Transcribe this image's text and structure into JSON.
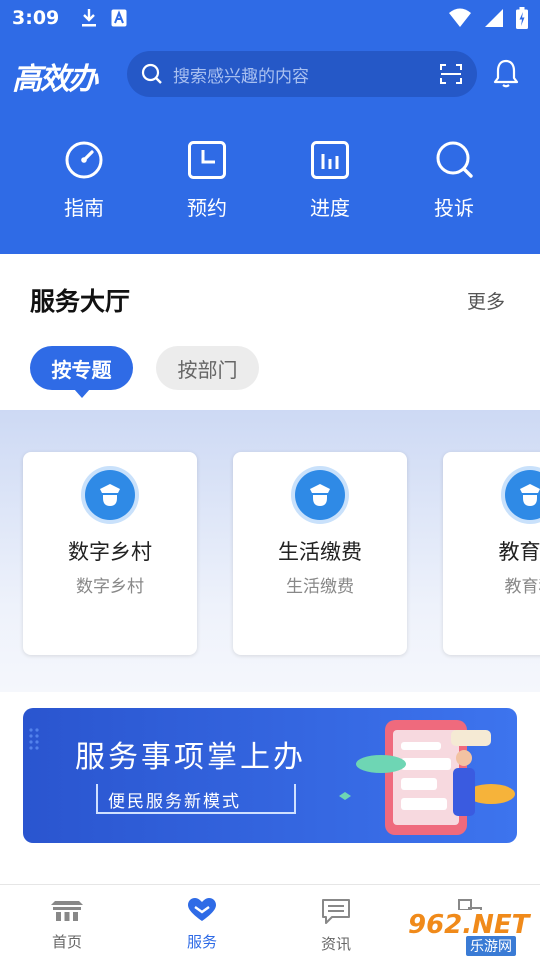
{
  "status_bar": {
    "time": "3:09",
    "left_icons": [
      "download-icon",
      "font-icon"
    ],
    "right_icons": [
      "wifi-icon",
      "signal-icon",
      "battery-icon"
    ]
  },
  "header": {
    "logo": "高效办",
    "search": {
      "placeholder": "搜索感兴趣的内容"
    },
    "quick_actions": [
      {
        "label": "指南",
        "icon": "gauge-icon"
      },
      {
        "label": "预约",
        "icon": "clock-icon"
      },
      {
        "label": "进度",
        "icon": "bar-chart-icon"
      },
      {
        "label": "投诉",
        "icon": "search-icon"
      }
    ],
    "accent_color": "#2f6be6"
  },
  "service_hall": {
    "title": "服务大厅",
    "more": "更多",
    "tabs": [
      {
        "label": "按专题",
        "active": true
      },
      {
        "label": "按部门",
        "active": false
      }
    ],
    "cards": [
      {
        "title": "数字乡村",
        "subtitle": "数字乡村",
        "icon": "officer-icon"
      },
      {
        "title": "生活缴费",
        "subtitle": "生活缴费",
        "icon": "officer-icon"
      },
      {
        "title": "教育科",
        "subtitle": "教育科",
        "icon": "officer-icon"
      }
    ]
  },
  "banner": {
    "title": "服务事项掌上办",
    "subtitle": "便民服务新模式"
  },
  "tab_bar": {
    "items": [
      {
        "label": "首页",
        "icon": "home-icon",
        "active": false
      },
      {
        "label": "服务",
        "icon": "heart-icon",
        "active": true
      },
      {
        "label": "资讯",
        "icon": "message-icon",
        "active": false
      },
      {
        "label": "",
        "icon": "switch-icon",
        "active": false
      }
    ]
  },
  "watermark": {
    "brand": "962.NET",
    "site": "乐游网"
  }
}
